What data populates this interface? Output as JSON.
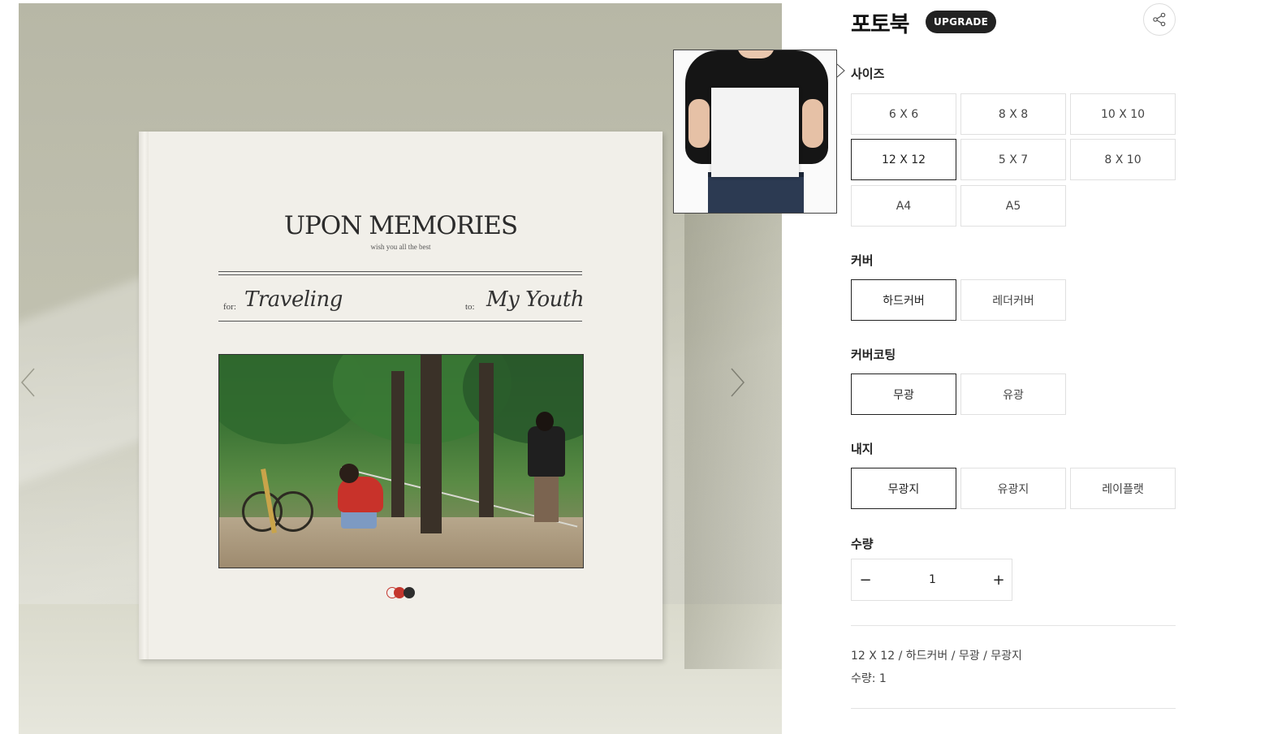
{
  "product": {
    "title": "포토북",
    "badge": "UPGRADE",
    "share_icon": "share-icon"
  },
  "book_cover": {
    "title": "UPON MEMORIES",
    "subtitle": "wish you all the best",
    "for_label": "for:",
    "for_value": "Traveling",
    "to_label": "to:",
    "to_value": "My Youth",
    "swatches": [
      "#f4f1ee",
      "#c4372e",
      "#2e2e2e"
    ]
  },
  "gallery": {
    "prev_icon": "chevron-left-icon",
    "next_icon": "chevron-right-icon"
  },
  "options": {
    "size": {
      "label": "사이즈",
      "items": [
        "6 X 6",
        "8 X 8",
        "10 X 10",
        "12 X 12",
        "5 X 7",
        "8 X 10",
        "A4",
        "A5"
      ],
      "selected": "12 X 12"
    },
    "cover": {
      "label": "커버",
      "items": [
        "하드커버",
        "레더커버"
      ],
      "selected": "하드커버"
    },
    "coating": {
      "label": "커버코팅",
      "items": [
        "무광",
        "유광"
      ],
      "selected": "무광"
    },
    "inner": {
      "label": "내지",
      "items": [
        "무광지",
        "유광지",
        "레이플랫"
      ],
      "selected": "무광지"
    },
    "quantity": {
      "label": "수량",
      "minus": "−",
      "value": "1",
      "plus": "+"
    }
  },
  "summary": {
    "options_text": "12 X 12 / 하드커버 / 무광 / 무광지",
    "quantity_text": "수량: 1"
  },
  "colors": {
    "selected_border": "#222222",
    "default_border": "#e0e0e0",
    "badge_bg": "#222222"
  }
}
